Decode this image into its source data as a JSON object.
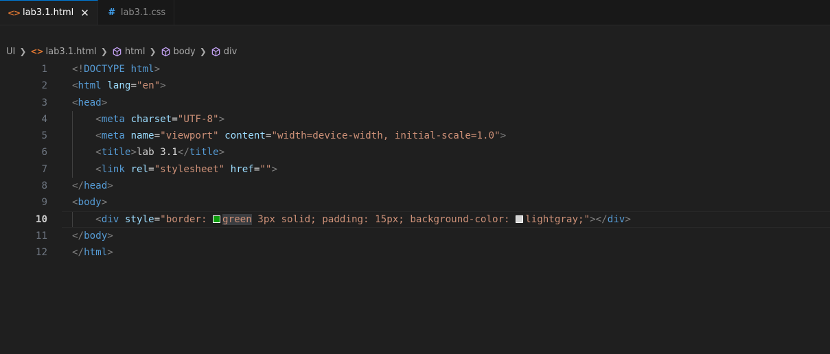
{
  "tabs": [
    {
      "label": "lab3.1.html",
      "icon": "html-file-icon",
      "active": true,
      "close": "✕"
    },
    {
      "label": "lab3.1.css",
      "icon": "css-file-icon",
      "active": false
    }
  ],
  "breadcrumb": {
    "root": "UI",
    "file": "lab3.1.html",
    "items": [
      "html",
      "body",
      "div"
    ]
  },
  "lines": [
    {
      "n": "1",
      "tokens": [
        [
          "br",
          "<!"
        ],
        [
          "doc",
          "DOCTYPE"
        ],
        [
          "txt",
          " "
        ],
        [
          "tag",
          "html"
        ],
        [
          "br",
          ">"
        ]
      ]
    },
    {
      "n": "2",
      "tokens": [
        [
          "br",
          "<"
        ],
        [
          "tag",
          "html"
        ],
        [
          "txt",
          " "
        ],
        [
          "attr",
          "lang"
        ],
        [
          "txt",
          "="
        ],
        [
          "str",
          "\"en\""
        ],
        [
          "br",
          ">"
        ]
      ]
    },
    {
      "n": "3",
      "tokens": [
        [
          "br",
          "<"
        ],
        [
          "tag",
          "head"
        ],
        [
          "br",
          ">"
        ]
      ]
    },
    {
      "n": "4",
      "indent": true,
      "tokens": [
        [
          "br",
          "<"
        ],
        [
          "tag",
          "meta"
        ],
        [
          "txt",
          " "
        ],
        [
          "attr",
          "charset"
        ],
        [
          "txt",
          "="
        ],
        [
          "str",
          "\"UTF-8\""
        ],
        [
          "br",
          ">"
        ]
      ]
    },
    {
      "n": "5",
      "indent": true,
      "tokens": [
        [
          "br",
          "<"
        ],
        [
          "tag",
          "meta"
        ],
        [
          "txt",
          " "
        ],
        [
          "attr",
          "name"
        ],
        [
          "txt",
          "="
        ],
        [
          "str",
          "\"viewport\""
        ],
        [
          "txt",
          " "
        ],
        [
          "attr",
          "content"
        ],
        [
          "txt",
          "="
        ],
        [
          "str",
          "\"width=device-width, initial-scale=1.0\""
        ],
        [
          "br",
          ">"
        ]
      ]
    },
    {
      "n": "6",
      "indent": true,
      "tokens": [
        [
          "br",
          "<"
        ],
        [
          "tag",
          "title"
        ],
        [
          "br",
          ">"
        ],
        [
          "txt",
          "lab 3.1"
        ],
        [
          "br",
          "</"
        ],
        [
          "tag",
          "title"
        ],
        [
          "br",
          ">"
        ]
      ]
    },
    {
      "n": "7",
      "indent": true,
      "tokens": [
        [
          "br",
          "<"
        ],
        [
          "tag",
          "link"
        ],
        [
          "txt",
          " "
        ],
        [
          "attr",
          "rel"
        ],
        [
          "txt",
          "="
        ],
        [
          "str",
          "\"stylesheet\""
        ],
        [
          "txt",
          " "
        ],
        [
          "attr",
          "href"
        ],
        [
          "txt",
          "="
        ],
        [
          "str",
          "\"\""
        ],
        [
          "br",
          ">"
        ]
      ]
    },
    {
      "n": "8",
      "tokens": [
        [
          "br",
          "</"
        ],
        [
          "tag",
          "head"
        ],
        [
          "br",
          ">"
        ]
      ]
    },
    {
      "n": "9",
      "tokens": [
        [
          "br",
          "<"
        ],
        [
          "tag",
          "body"
        ],
        [
          "br",
          ">"
        ]
      ]
    },
    {
      "n": "10",
      "indent": true,
      "current": true,
      "tokens": [
        [
          "br",
          "<"
        ],
        [
          "tag",
          "div"
        ],
        [
          "txt",
          " "
        ],
        [
          "attr",
          "style"
        ],
        [
          "txt",
          "="
        ],
        [
          "str",
          "\"border: "
        ],
        [
          "sw",
          "#0e9c0e"
        ],
        [
          "strhl",
          "green"
        ],
        [
          "str",
          " 3px solid; padding: 15px; background-color: "
        ],
        [
          "sw",
          "#d3d3d3"
        ],
        [
          "str",
          "lightgray;\""
        ],
        [
          "br",
          "></"
        ],
        [
          "tag",
          "div"
        ],
        [
          "br",
          ">"
        ]
      ]
    },
    {
      "n": "11",
      "tokens": [
        [
          "br",
          "</"
        ],
        [
          "tag",
          "body"
        ],
        [
          "br",
          ">"
        ]
      ]
    },
    {
      "n": "12",
      "tokens": [
        [
          "br",
          "</"
        ],
        [
          "tag",
          "html"
        ],
        [
          "br",
          ">"
        ]
      ]
    }
  ]
}
